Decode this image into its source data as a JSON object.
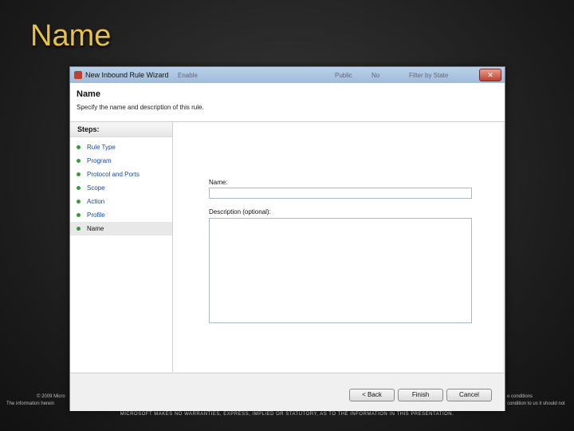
{
  "slide": {
    "title": "Name",
    "footer_left_1": "© 2009 Micro",
    "footer_left_2": "The information herein",
    "footer_right_1": "e conditions",
    "footer_right_2": "condition to us it should not",
    "footer_bottom": "MICROSOFT MAKES NO WARRANTIES, EXPRESS, IMPLIED OR STATUTORY, AS TO THE INFORMATION IN THIS PRESENTATION."
  },
  "window": {
    "title": "New Inbound Rule Wizard",
    "close_label": "✕",
    "ghost_1": "Enable",
    "ghost_2": "Public",
    "ghost_3": "No",
    "ghost_4": "Filter by State"
  },
  "header": {
    "title": "Name",
    "subtitle": "Specify the name and description of this rule."
  },
  "steps": {
    "heading": "Steps:",
    "items": [
      {
        "label": "Rule Type"
      },
      {
        "label": "Program"
      },
      {
        "label": "Protocol and Ports"
      },
      {
        "label": "Scope"
      },
      {
        "label": "Action"
      },
      {
        "label": "Profile"
      },
      {
        "label": "Name"
      }
    ]
  },
  "form": {
    "name_label": "Name:",
    "name_value": "",
    "description_label": "Description (optional):",
    "description_value": ""
  },
  "buttons": {
    "back": "< Back",
    "finish": "Finish",
    "cancel": "Cancel"
  }
}
